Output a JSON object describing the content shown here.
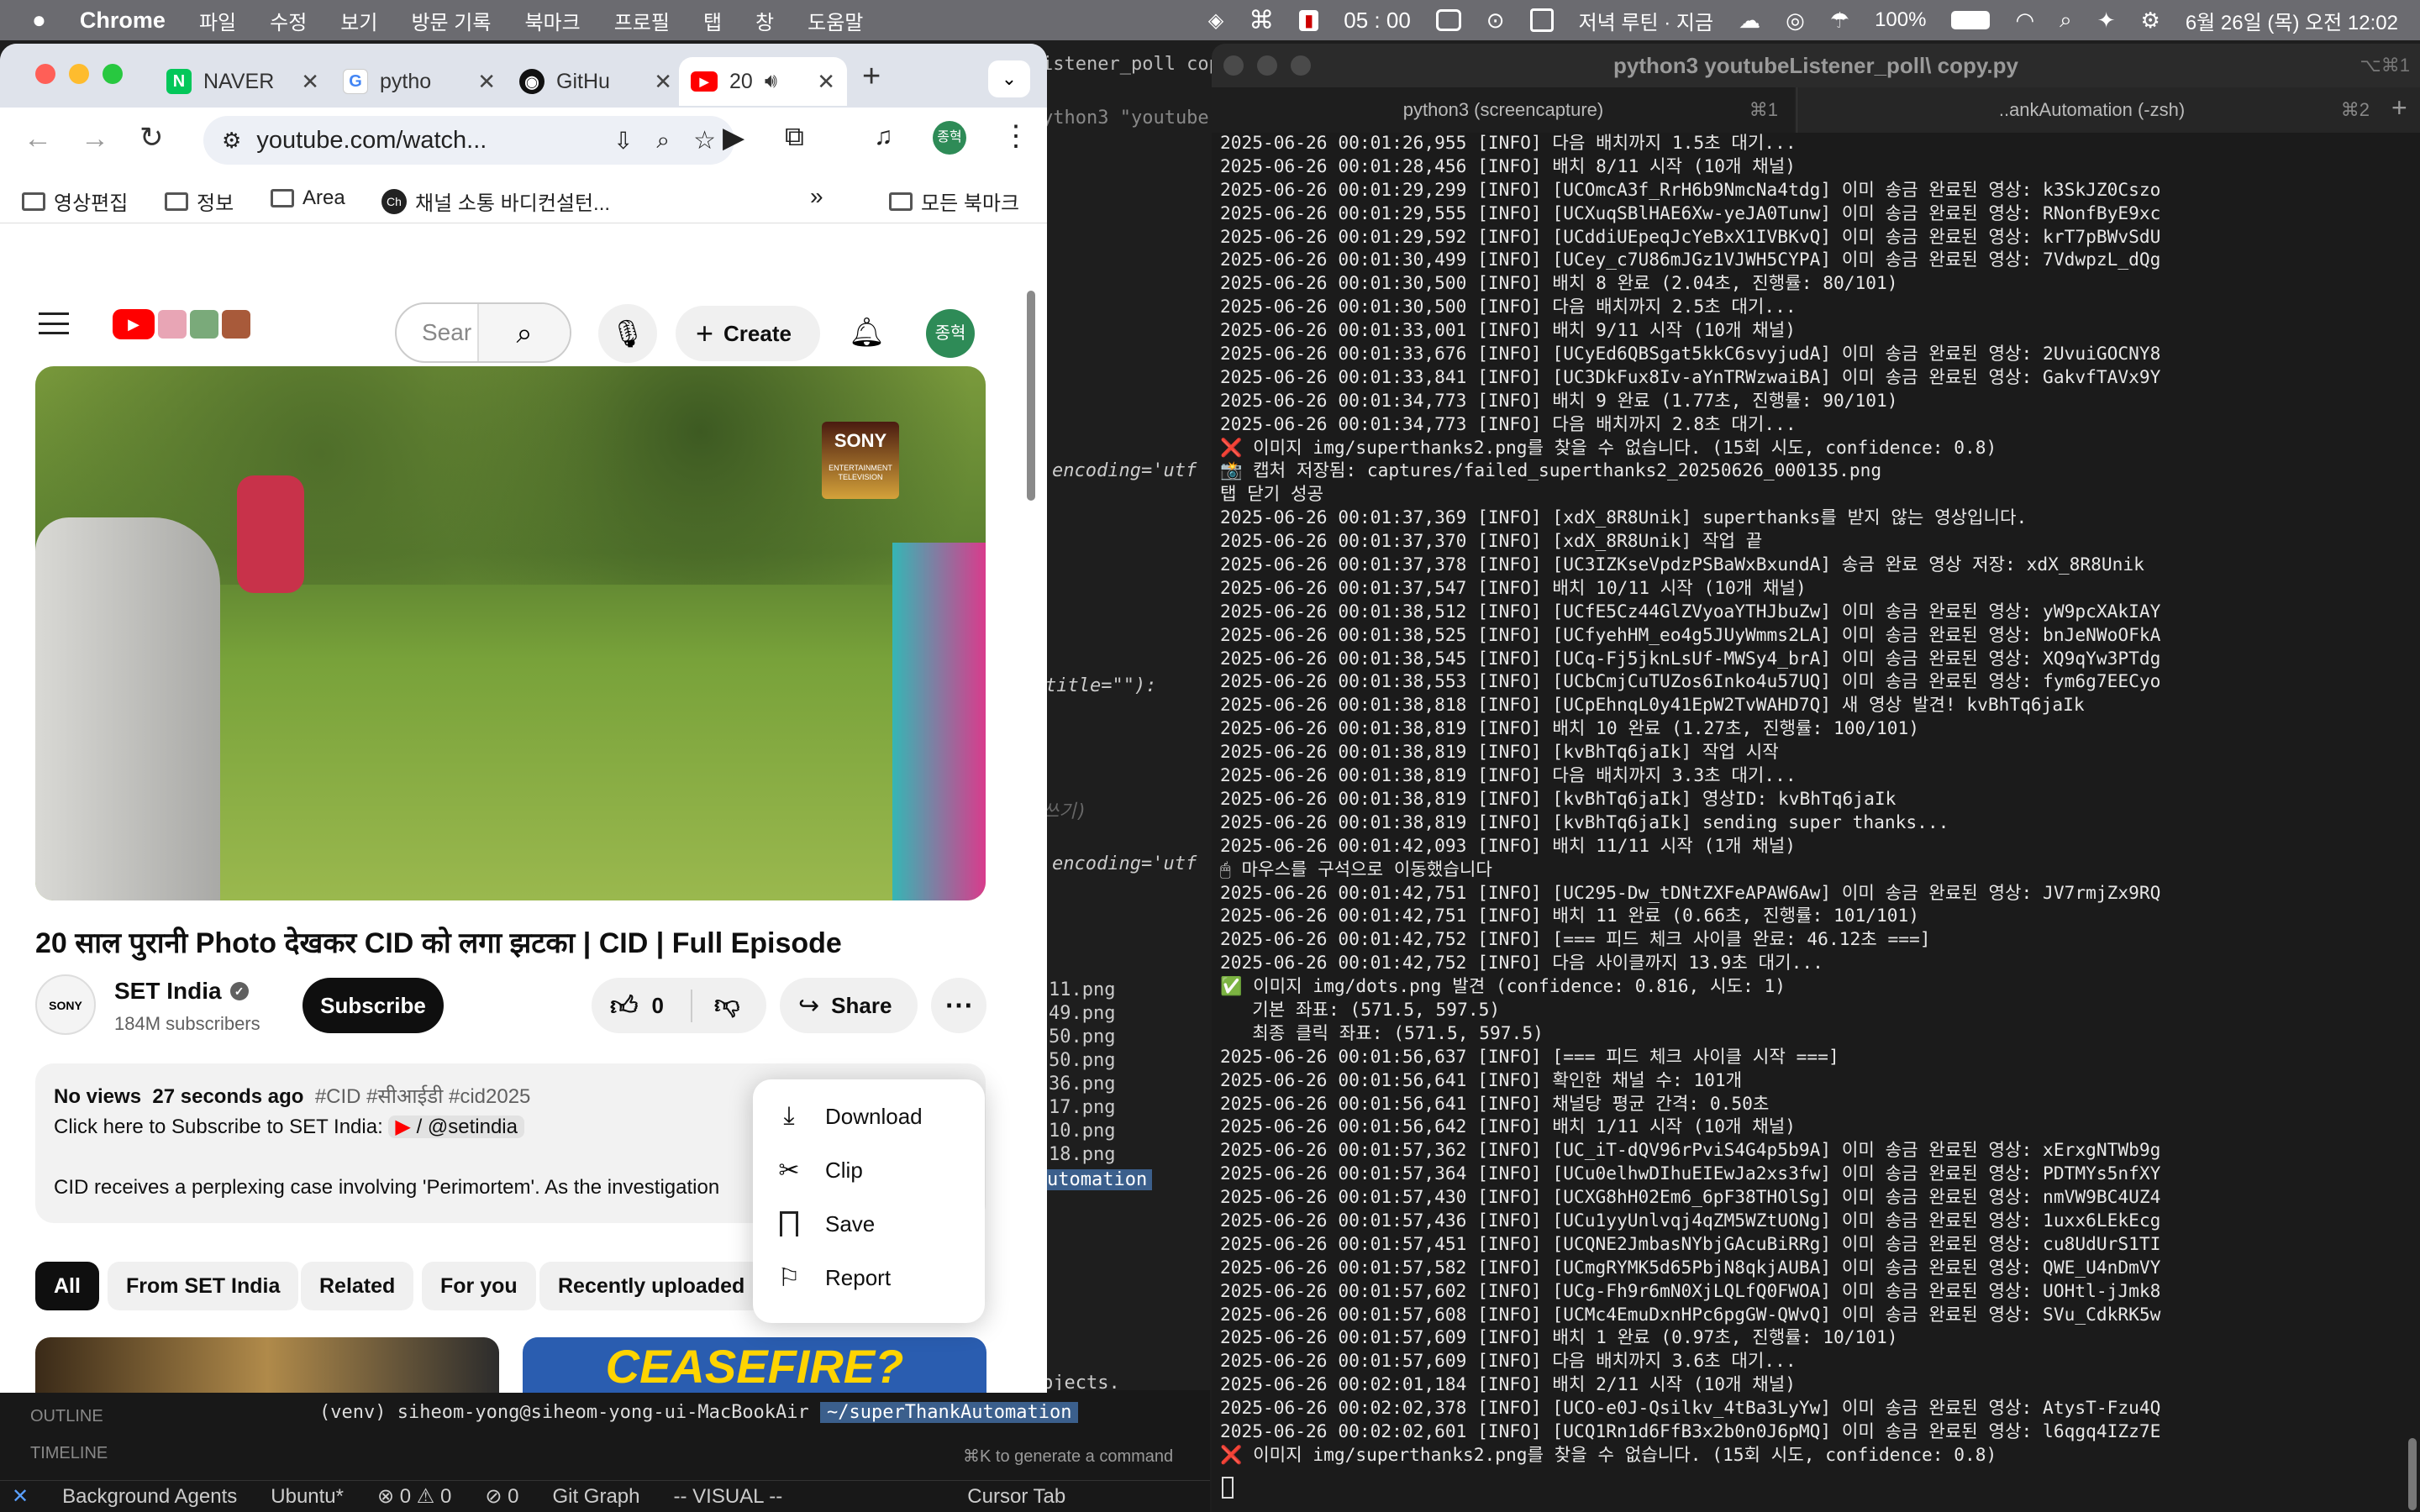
{
  "menubar": {
    "app": "Chrome",
    "items": [
      "파일",
      "수정",
      "보기",
      "방문 기록",
      "북마크",
      "프로필",
      "탭",
      "창",
      "도움말"
    ],
    "timer": "05 : 00",
    "reminder": "저녁 루틴 · 지금",
    "battery": "100%",
    "datetime": "6월 26일 (목) 오전 12:02"
  },
  "chrome": {
    "tabs": [
      {
        "label": "NAVER",
        "icon": "naver-icon"
      },
      {
        "label": "pytho",
        "icon": "google-icon"
      },
      {
        "label": "GitHu",
        "icon": "github-icon"
      },
      {
        "label": "20",
        "icon": "youtube-icon"
      }
    ],
    "url": "youtube.com/watch...",
    "profile_initial": "종혁",
    "bookmarks": [
      "영상편집",
      "정보",
      "Area",
      "채널 소통 바디컨설턴...",
      "모든 북마크"
    ]
  },
  "youtube": {
    "search_placeholder": "Sear",
    "create_label": "Create",
    "avatar": "종혁",
    "video_title": "20 साल पुरानी Photo देखकर CID को लगा झटका | CID | Full Episode",
    "channel": {
      "name": "SET India",
      "subscribers": "184M subscribers",
      "subscribe_label": "Subscribe"
    },
    "likes": "0",
    "share_label": "Share",
    "description": {
      "views": "No views",
      "time": "27 seconds ago",
      "tags": "#CID #सीआईडी #cid2025",
      "line1": "Click here to Subscribe to SET India:",
      "handle": "/ @setindia",
      "line2": "CID receives a perplexing case involving 'Perimortem'. As the investigation"
    },
    "menu": [
      "Download",
      "Clip",
      "Save",
      "Report"
    ],
    "chips": [
      "All",
      "From SET India",
      "Related",
      "For you",
      "Recently uploaded"
    ],
    "thumb2_text": "CEASEFIRE?",
    "sony_logo": "SONY",
    "sony_sub": "ENTERTAINMENT TELEVISION"
  },
  "vscode": {
    "fragments": [
      "istener_poll copy.p",
      "ython3 \"youtube",
      "encoding='utf",
      "title=\"\"):",
      "쓰기)",
      "encoding='utf",
      "11.png",
      "49.png",
      "50.png",
      "50.png",
      "36.png",
      "17.png",
      "10.png",
      "18.png",
      "utomation",
      "bjects."
    ],
    "outline": "OUTLINE",
    "timeline": "TIMELINE",
    "prompt": "(venv)  siheom-yong@siheom-yong-ui-MacBookAir",
    "prompt_path": "~/superThankAutomation",
    "gen_hint": "⌘K to generate a command",
    "status": [
      "Background Agents",
      "Ubuntu*",
      "⊗ 0 ⚠ 0",
      "⊘ 0",
      "Git Graph",
      "-- VISUAL --",
      "Cursor Tab"
    ]
  },
  "terminal": {
    "title": "python3 youtubeListener_poll\\ copy.py",
    "tab1": "python3 (screencapture)",
    "tab1_key": "⌘1",
    "tab2": "..ankAutomation (-zsh)",
    "tab2_key": "⌘2",
    "lines": [
      "2025-06-26 00:01:26,955 [INFO] 다음 배치까지 1.5초 대기...",
      "2025-06-26 00:01:28,456 [INFO] 배치 8/11 시작 (10개 채널)",
      "2025-06-26 00:01:29,299 [INFO] [UCOmcA3f_RrH6b9NmcNa4tdg] 이미 송금 완료된 영상: k3SkJZ0Cszo",
      "2025-06-26 00:01:29,555 [INFO] [UCXuqSBlHAE6Xw-yeJA0Tunw] 이미 송금 완료된 영상: RNonfByE9xc",
      "2025-06-26 00:01:29,592 [INFO] [UCddiUEpeqJcYeBxX1IVBKvQ] 이미 송금 완료된 영상: krT7pBWvSdU",
      "2025-06-26 00:01:30,499 [INFO] [UCey_c7U86mJGz1VJWH5CYPA] 이미 송금 완료된 영상: 7VdwpzL_dQg",
      "2025-06-26 00:01:30,500 [INFO] 배치 8 완료 (2.04초, 진행률: 80/101)",
      "2025-06-26 00:01:30,500 [INFO] 다음 배치까지 2.5초 대기...",
      "2025-06-26 00:01:33,001 [INFO] 배치 9/11 시작 (10개 채널)",
      "2025-06-26 00:01:33,676 [INFO] [UCyEd6QBSgat5kkC6svyjudA] 이미 송금 완료된 영상: 2UvuiGOCNY8",
      "2025-06-26 00:01:33,841 [INFO] [UC3DkFux8Iv-aYnTRWzwaiBA] 이미 송금 완료된 영상: GakvfTAVx9Y",
      "2025-06-26 00:01:34,773 [INFO] 배치 9 완료 (1.77초, 진행률: 90/101)",
      "2025-06-26 00:01:34,773 [INFO] 다음 배치까지 2.8초 대기...",
      "❌ 이미지 img/superthanks2.png를 찾을 수 없습니다. (15회 시도, confidence: 0.8)",
      "📸 캡처 저장됨: captures/failed_superthanks2_20250626_000135.png",
      "탭 닫기 성공",
      "2025-06-26 00:01:37,369 [INFO] [xdX_8R8Unik] superthanks를 받지 않는 영상입니다.",
      "2025-06-26 00:01:37,370 [INFO] [xdX_8R8Unik] 작업 끝",
      "2025-06-26 00:01:37,378 [INFO] [UC3IZKseVpdzPSBaWxBxundA] 송금 완료 영상 저장: xdX_8R8Unik",
      "2025-06-26 00:01:37,547 [INFO] 배치 10/11 시작 (10개 채널)",
      "2025-06-26 00:01:38,512 [INFO] [UCfE5Cz44GlZVyoaYTHJbuZw] 이미 송금 완료된 영상: yW9pcXAkIAY",
      "2025-06-26 00:01:38,525 [INFO] [UCfyehHM_eo4g5JUyWmms2LA] 이미 송금 완료된 영상: bnJeNWoOFkA",
      "2025-06-26 00:01:38,545 [INFO] [UCq-Fj5jknLsUf-MWSy4_brA] 이미 송금 완료된 영상: XQ9qYw3PTdg",
      "2025-06-26 00:01:38,553 [INFO] [UCbCmjCuTUZos6Inko4u57UQ] 이미 송금 완료된 영상: fym6g7EECyo",
      "2025-06-26 00:01:38,818 [INFO] [UCpEhnqL0y41EpW2TvWAHD7Q] 새 영상 발견! kvBhTq6jaIk",
      "2025-06-26 00:01:38,819 [INFO] 배치 10 완료 (1.27초, 진행률: 100/101)",
      "2025-06-26 00:01:38,819 [INFO] [kvBhTq6jaIk] 작업 시작",
      "2025-06-26 00:01:38,819 [INFO] 다음 배치까지 3.3초 대기...",
      "2025-06-26 00:01:38,819 [INFO] [kvBhTq6jaIk] 영상ID: kvBhTq6jaIk",
      "2025-06-26 00:01:38,819 [INFO] [kvBhTq6jaIk] sending super thanks...",
      "2025-06-26 00:01:42,093 [INFO] 배치 11/11 시작 (1개 채널)",
      "🖱 마우스를 구석으로 이동했습니다",
      "2025-06-26 00:01:42,751 [INFO] [UC295-Dw_tDNtZXFeAPAW6Aw] 이미 송금 완료된 영상: JV7rmjZx9RQ",
      "2025-06-26 00:01:42,751 [INFO] 배치 11 완료 (0.66초, 진행률: 101/101)",
      "2025-06-26 00:01:42,752 [INFO] [=== 피드 체크 사이클 완료: 46.12초 ===]",
      "2025-06-26 00:01:42,752 [INFO] 다음 사이클까지 13.9초 대기...",
      "✅ 이미지 img/dots.png 발견 (confidence: 0.816, 시도: 1)",
      "   기본 좌표: (571.5, 597.5)",
      "   최종 클릭 좌표: (571.5, 597.5)",
      "2025-06-26 00:01:56,637 [INFO] [=== 피드 체크 사이클 시작 ===]",
      "2025-06-26 00:01:56,641 [INFO] 확인한 채널 수: 101개",
      "2025-06-26 00:01:56,641 [INFO] 채널당 평균 간격: 0.50초",
      "2025-06-26 00:01:56,642 [INFO] 배치 1/11 시작 (10개 채널)",
      "2025-06-26 00:01:57,362 [INFO] [UC_iT-dQV96rPviS4G4p5b9A] 이미 송금 완료된 영상: xErxgNTWb9g",
      "2025-06-26 00:01:57,364 [INFO] [UCu0elhwDIhuEIEwJa2xs3fw] 이미 송금 완료된 영상: PDTMYs5nfXY",
      "2025-06-26 00:01:57,430 [INFO] [UCXG8hH02Em6_6pF38THOlSg] 이미 송금 완료된 영상: nmVW9BC4UZ4",
      "2025-06-26 00:01:57,436 [INFO] [UCu1yyUnlvqj4qZM5WZtUONg] 이미 송금 완료된 영상: 1uxx6LEkEcg",
      "2025-06-26 00:01:57,451 [INFO] [UCQNE2JmbasNYbjGAcuBiRRg] 이미 송금 완료된 영상: cu8UdUrS1TI",
      "2025-06-26 00:01:57,582 [INFO] [UCmgRYMK5d65PbjN8qkjAUBA] 이미 송금 완료된 영상: QWE_U4nDmVY",
      "2025-06-26 00:01:57,602 [INFO] [UCg-Fh9r6mN0XjLQLfQ0FWOA] 이미 송금 완료된 영상: UOHtl-jJmk8",
      "2025-06-26 00:01:57,608 [INFO] [UCMc4EmuDxnHPc6pgGW-QWvQ] 이미 송금 완료된 영상: SVu_CdkRK5w",
      "2025-06-26 00:01:57,609 [INFO] 배치 1 완료 (0.97초, 진행률: 10/101)",
      "2025-06-26 00:01:57,609 [INFO] 다음 배치까지 3.6초 대기...",
      "2025-06-26 00:02:01,184 [INFO] 배치 2/11 시작 (10개 채널)",
      "2025-06-26 00:02:02,378 [INFO] [UCO-e0J-Qsilkv_4tBa3LyYw] 이미 송금 완료된 영상: AtysT-Fzu4Q",
      "2025-06-26 00:02:02,601 [INFO] [UCQ1Rn1d6FfB3x2b0n0J6pMQ] 이미 송금 완료된 영상: l6qgq4IZz7E",
      "❌ 이미지 img/superthanks2.png를 찾을 수 없습니다. (15회 시도, confidence: 0.8)"
    ]
  }
}
